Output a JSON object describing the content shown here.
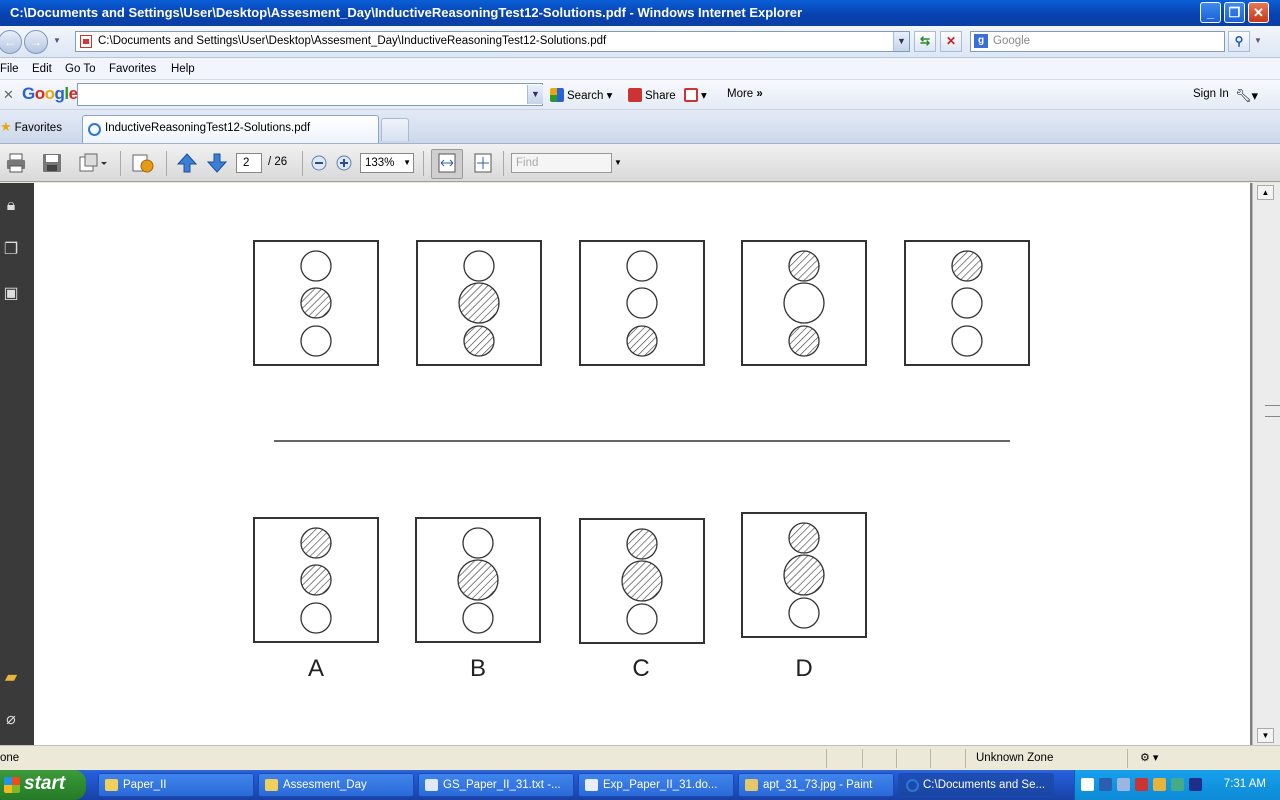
{
  "window": {
    "title": "C:\\Documents and Settings\\User\\Desktop\\Assesment_Day\\InductiveReasoningTest12-Solutions.pdf - Windows Internet Explorer"
  },
  "address_bar": {
    "url": "C:\\Documents and Settings\\User\\Desktop\\Assesment_Day\\InductiveReasoningTest12-Solutions.pdf",
    "search_placeholder": "Google"
  },
  "menu": [
    "File",
    "Edit",
    "Go To",
    "Favorites",
    "Help"
  ],
  "google_toolbar": {
    "logo": "Google",
    "search_label": "Search",
    "share_label": "Share",
    "more_label": "More",
    "sign_in_label": "Sign In"
  },
  "tabs": {
    "favorites_label": "Favorites",
    "active_tab": "InductiveReasoningTest12-Solutions.pdf"
  },
  "pdf_toolbar": {
    "current_page": "2",
    "total_pages": "/ 26",
    "zoom": "133%",
    "find_placeholder": "Find"
  },
  "document": {
    "option_labels": [
      "A",
      "B",
      "C",
      "D"
    ],
    "question_boxes": [
      [
        "plain",
        "hatched",
        "plain"
      ],
      [
        "plain",
        "hatched-large",
        "hatched"
      ],
      [
        "plain",
        "plain",
        "hatched"
      ],
      [
        "hatched",
        "plain-large",
        "hatched"
      ],
      [
        "hatched",
        "plain",
        "plain"
      ]
    ],
    "answer_boxes": [
      [
        "hatched",
        "hatched",
        "plain"
      ],
      [
        "plain",
        "hatched-large",
        "plain"
      ],
      [
        "hatched",
        "hatched-large",
        "plain"
      ],
      [
        "hatched",
        "hatched-large",
        "plain"
      ]
    ]
  },
  "status_bar": {
    "left_text": "one",
    "zone": "Unknown Zone"
  },
  "taskbar": {
    "start_label": "start",
    "items": [
      "Paper_II",
      "Assesment_Day",
      "GS_Paper_II_31.txt -...",
      "Exp_Paper_II_31.do...",
      "apt_31_73.jpg - Paint",
      "C:\\Documents and Se..."
    ],
    "clock": "7:31 AM"
  }
}
